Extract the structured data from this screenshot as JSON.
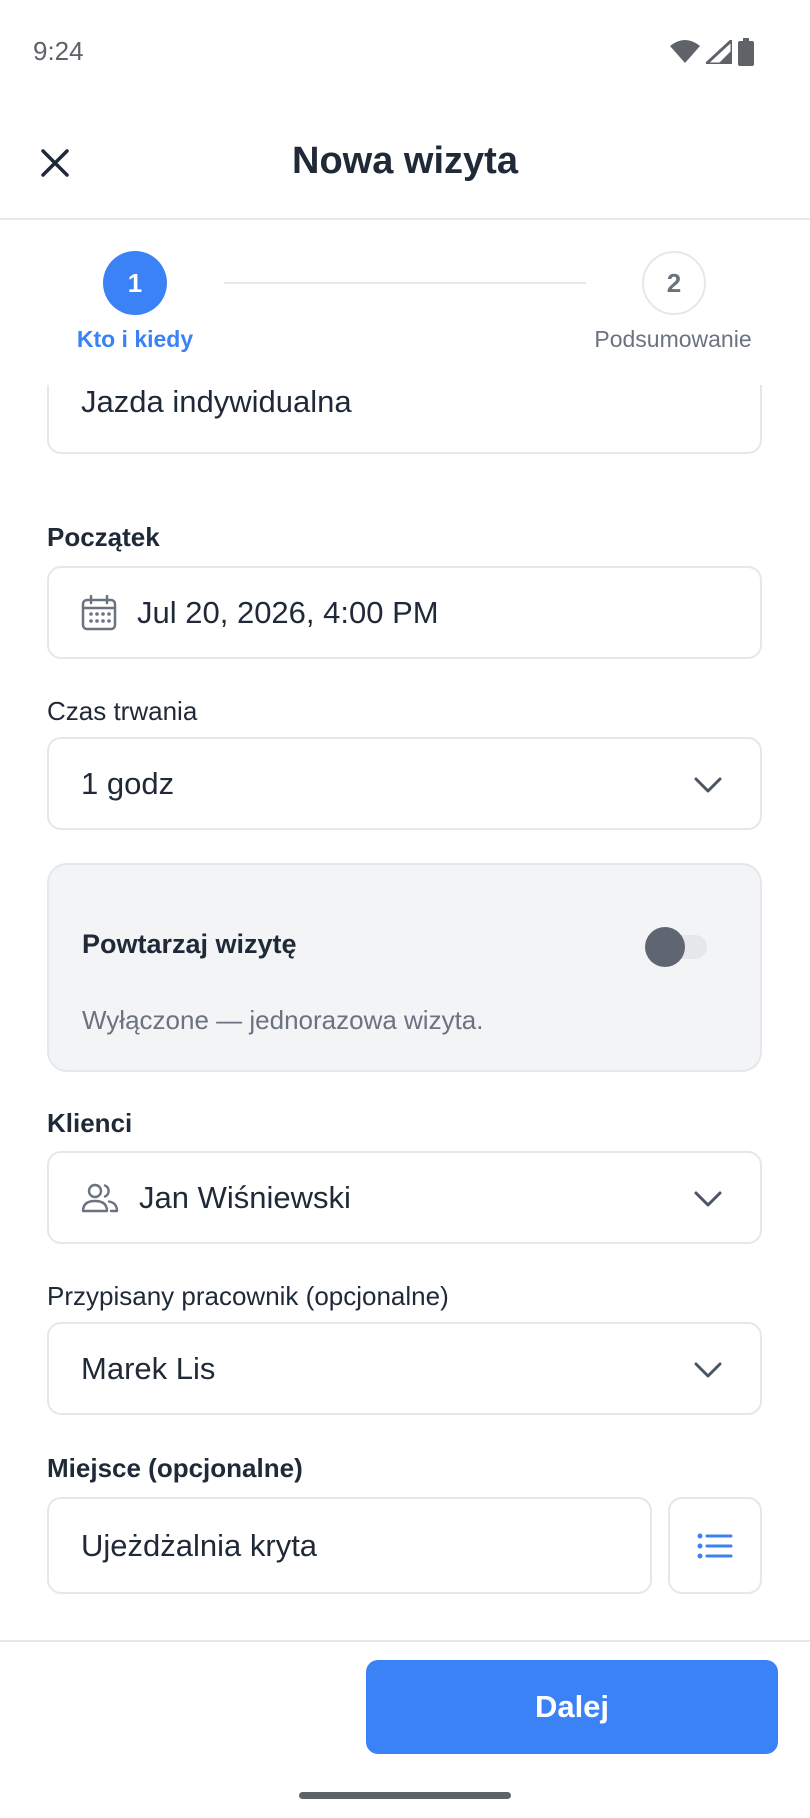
{
  "status_bar": {
    "time": "9:24",
    "icons": [
      "wifi-icon",
      "signal-icon",
      "battery-icon"
    ]
  },
  "header": {
    "title": "Nowa wizyta",
    "close_icon": "close-icon"
  },
  "stepper": {
    "steps": [
      {
        "number": "1",
        "label": "Kto i kiedy",
        "active": true
      },
      {
        "number": "2",
        "label": "Podsumowanie",
        "active": false
      }
    ]
  },
  "form": {
    "lesson_type": {
      "value": "Jazda indywidualna"
    },
    "start": {
      "label": "Początek",
      "value": "Jul 20, 2026, 4:00 PM",
      "icon": "calendar-icon"
    },
    "duration": {
      "label": "Czas trwania",
      "value": "1 godz"
    },
    "repeat": {
      "title": "Powtarzaj wizytę",
      "subtitle": "Wyłączone — jednorazowa wizyta.",
      "enabled": false
    },
    "clients": {
      "label": "Klienci",
      "value": "Jan Wiśniewski",
      "icon": "users-icon"
    },
    "employee": {
      "label": "Przypisany pracownik (opcjonalne)",
      "value": "Marek Lis"
    },
    "place": {
      "label": "Miejsce (opcjonalne)",
      "value": "Ujeżdżalnia kryta",
      "button_icon": "list-icon"
    }
  },
  "footer": {
    "next_label": "Dalej"
  },
  "colors": {
    "accent": "#3b82f6",
    "text": "#1f2937",
    "muted": "#6b7280",
    "border": "#e5e7eb",
    "card": "#f3f4f6"
  }
}
